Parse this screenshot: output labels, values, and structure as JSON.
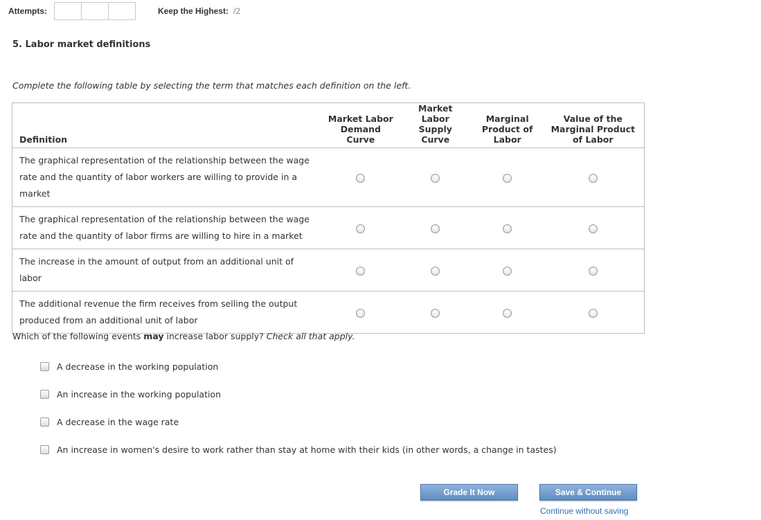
{
  "header": {
    "attempts_label": "Attempts:",
    "keep_label": "Keep the Highest:",
    "keep_value": "/2"
  },
  "question": {
    "title": "5. Labor market definitions",
    "instructions": "Complete the following table by selecting the term that matches each definition on the left."
  },
  "table": {
    "definition_header": "Definition",
    "columns": [
      {
        "line1": "Market Labor",
        "line2": "Demand",
        "line3": "Curve",
        "line4": ""
      },
      {
        "line1": "Market",
        "line2": "Labor",
        "line3": "Supply",
        "line4": "Curve"
      },
      {
        "line1": "Marginal",
        "line2": "Product of",
        "line3": "Labor",
        "line4": ""
      },
      {
        "line1": "Value of the",
        "line2": "Marginal Product",
        "line3": "of Labor",
        "line4": ""
      }
    ],
    "rows": [
      {
        "definition": "The graphical representation of the relationship between the wage rate and the quantity of labor workers are willing to provide in a market"
      },
      {
        "definition": "The graphical representation of the relationship between the wage rate and the quantity of labor firms are willing to hire in a market"
      },
      {
        "definition": "The increase in the amount of output from an additional unit of labor"
      },
      {
        "definition": "The additional revenue the firm receives from selling the output produced from an additional unit of labor"
      }
    ]
  },
  "question2": {
    "prefix": "Which of the following events ",
    "emphasis": "may",
    "middle": " increase labor supply? ",
    "hint": "Check all that apply.",
    "options": [
      "A decrease in the working population",
      "An increase in the working population",
      "A decrease in the wage rate",
      "An increase in women's desire to work rather than stay at home with their kids (in other words, a change in tastes)"
    ]
  },
  "actions": {
    "grade_label": "Grade It Now",
    "save_label": "Save & Continue",
    "continue_label": "Continue without saving"
  }
}
